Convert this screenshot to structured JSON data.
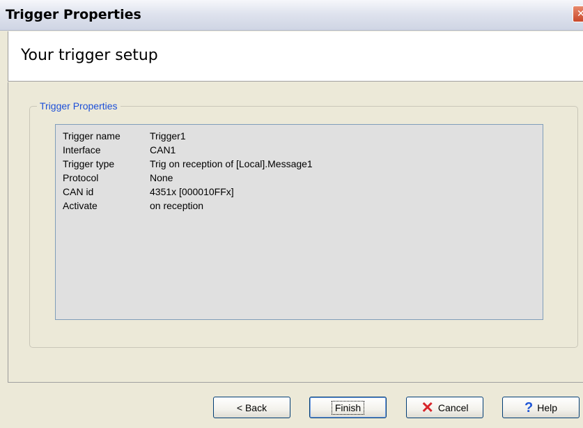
{
  "window": {
    "title": "Trigger Properties"
  },
  "header": {
    "heading": "Your trigger setup"
  },
  "group": {
    "legend": "Trigger Properties",
    "properties": [
      {
        "key": "Trigger name",
        "value": "Trigger1"
      },
      {
        "key": "Interface",
        "value": "CAN1"
      },
      {
        "key": "Trigger type",
        "value": "Trig on reception of [Local].Message1"
      },
      {
        "key": "Protocol",
        "value": "None"
      },
      {
        "key": "CAN id",
        "value": "4351x [000010FFx]"
      },
      {
        "key": "Activate",
        "value": "on reception"
      }
    ]
  },
  "buttons": {
    "back": "< Back",
    "finish": "Finish",
    "cancel": "Cancel",
    "help": "Help"
  },
  "icons": {
    "close": "close-icon",
    "cancel": "x-icon",
    "help": "question-icon"
  },
  "colors": {
    "legend": "#1c4fd8",
    "cancel_icon": "#d8262b",
    "help_icon": "#1f56d6"
  }
}
